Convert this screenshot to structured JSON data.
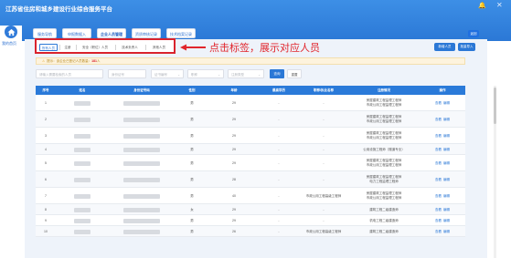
{
  "app": {
    "title": "江苏省住房和城乡建设行业综合服务平台",
    "home_label": "我的首页",
    "colors": {
      "brand": "#2b78d6",
      "accent_red": "#d9232d",
      "warning_bg": "#fdf3dd"
    }
  },
  "top_tabs": [
    {
      "label": "服务导航",
      "active": false
    },
    {
      "label": "申报数据入",
      "active": false
    },
    {
      "label": "企业人员管理",
      "active": true
    },
    {
      "label": "资质审核记录",
      "active": false
    },
    {
      "label": "技术档案记录",
      "active": false
    }
  ],
  "top_extra_button": "返回",
  "person_tabs": [
    {
      "label": "所有人员",
      "active": true
    },
    {
      "label": "注册",
      "active": false
    },
    {
      "label": "安全（职位）人员",
      "active": false
    },
    {
      "label": "技术负责人",
      "active": false
    },
    {
      "label": "其他人员",
      "active": false
    }
  ],
  "annotation": "点击标签，展示对应人员",
  "actions": [
    {
      "label": "新增人员",
      "color": "#2b78d6"
    },
    {
      "label": "批量导入",
      "color": "#2b78d6"
    }
  ],
  "notice": {
    "prefix": "提示：该企业已登记人员数量：",
    "count": "181",
    "suffix": "人"
  },
  "search": {
    "name_placeholder": "请输入需要检索的人员",
    "id_placeholder": "身份证号",
    "cert_placeholder": "证书编号",
    "status_placeholder": "职称",
    "type_placeholder": "注册类型",
    "query_button": "查询",
    "reset_button": "重置"
  },
  "table": {
    "columns": [
      "序号",
      "姓名",
      "身份证号码",
      "性别",
      "年龄",
      "最高学历",
      "职称/执业名称",
      "注册情况",
      "操作"
    ],
    "op_view": "查看",
    "op_edit": "编辑",
    "rows": [
      {
        "no": "1",
        "gender": "男",
        "age": "29",
        "edu": "-",
        "title": "-",
        "reg": [
          "房屋建筑工程监理工程师",
          "市政公用工程监理工程师"
        ]
      },
      {
        "no": "2",
        "gender": "男",
        "age": "29",
        "edu": "-",
        "title": "-",
        "reg": [
          "房屋建筑工程监理工程师",
          "市政公用工程监理工程师"
        ]
      },
      {
        "no": "3",
        "gender": "男",
        "age": "29",
        "edu": "-",
        "title": "-",
        "reg": [
          "房屋建筑工程监理工程师",
          "市政公用工程监理工程师"
        ]
      },
      {
        "no": "4",
        "gender": "男",
        "age": "29",
        "edu": "-",
        "title": "-",
        "reg": [
          "公用设施工程师（隧道专业）"
        ]
      },
      {
        "no": "5",
        "gender": "男",
        "age": "29",
        "edu": "-",
        "title": "-",
        "reg": [
          "房屋建筑工程监理工程师",
          "市政公用工程监理工程师"
        ]
      },
      {
        "no": "6",
        "gender": "男",
        "age": "28",
        "edu": "-",
        "title": "-",
        "reg": [
          "房屋建筑工程监理工程师",
          "电力工程监理工程师"
        ]
      },
      {
        "no": "7",
        "gender": "男",
        "age": "40",
        "edu": "-",
        "title": "市政公用工程高级工程师",
        "reg": [
          "房屋建筑工程监理工程师",
          "市政公用工程监理工程师"
        ]
      },
      {
        "no": "8",
        "gender": "女",
        "age": "29",
        "edu": "-",
        "title": "-",
        "reg": [
          "建筑工程二级建造师"
        ]
      },
      {
        "no": "9",
        "gender": "男",
        "age": "29",
        "edu": "-",
        "title": "-",
        "reg": [
          "机电工程二级建造师"
        ]
      },
      {
        "no": "10",
        "gender": "男",
        "age": "26",
        "edu": "-",
        "title": "市政公用工程高级工程师",
        "reg": [
          "建筑工程二级建造师"
        ]
      }
    ]
  }
}
